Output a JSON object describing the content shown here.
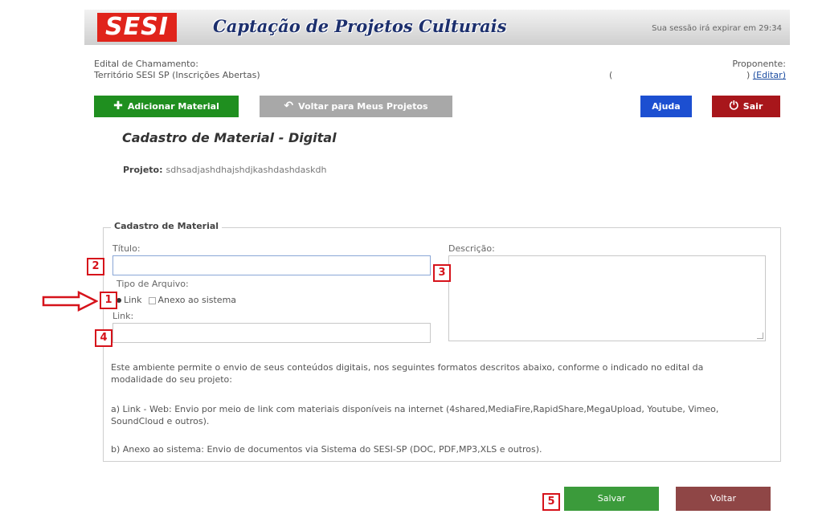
{
  "header": {
    "logo": "SESI",
    "title": "Captação de Projetos Culturais",
    "session": "Sua sessão irá expirar em 29:34"
  },
  "edital": {
    "label": "Edital de Chamamento:",
    "value": "Território SESI SP (Inscrições Abertas)"
  },
  "proponente": {
    "label": "Proponente:",
    "paren_open": "(",
    "paren_close": ")",
    "edit_link": "(Editar)"
  },
  "toolbar": {
    "add_label": "Adicionar Material",
    "add_icon": "plus-icon",
    "back_projects_label": "Voltar para Meus Projetos",
    "back_icon": "undo-icon",
    "help_label": "Ajuda",
    "exit_label": "Sair",
    "exit_icon": "power-icon"
  },
  "page": {
    "title": "Cadastro de Material - Digital",
    "projeto_label": "Projeto:",
    "projeto_value": "sdhsadjashdhajshdjkashdashdaskdh"
  },
  "form": {
    "legend": "Cadastro de Material",
    "titulo_label": "Título:",
    "titulo_value": "",
    "descricao_label": "Descrição:",
    "descricao_value": "",
    "tipo_label": "Tipo de Arquivo:",
    "tipo_options": [
      "Link",
      "Anexo ao sistema"
    ],
    "tipo_selected": "Link",
    "link_label": "Link:",
    "link_value": ""
  },
  "info": {
    "intro": "Este ambiente permite o envio de seus conteúdos digitais, nos seguintes formatos descritos abaixo, conforme o indicado no edital da modalidade do seu projeto:",
    "item_a": "a) Link - Web: Envio por meio de link com materiais disponíveis na internet (4shared,MediaFire,RapidShare,MegaUpload, Youtube, Vimeo, SoundCloud e outros).",
    "item_b": "b) Anexo ao sistema: Envio de documentos via Sistema do SESI-SP (DOC, PDF,MP3,XLS e outros)."
  },
  "markers": [
    "1",
    "2",
    "3",
    "4",
    "5"
  ],
  "actions": {
    "save_label": "Salvar",
    "back_label": "Voltar"
  },
  "colors": {
    "brand_red": "#e0241b",
    "title_blue": "#1c2f6d",
    "green": "#1f8f1f",
    "help_blue": "#1c4fd1",
    "exit_red": "#a8161b",
    "marker_red": "#d6131b"
  }
}
